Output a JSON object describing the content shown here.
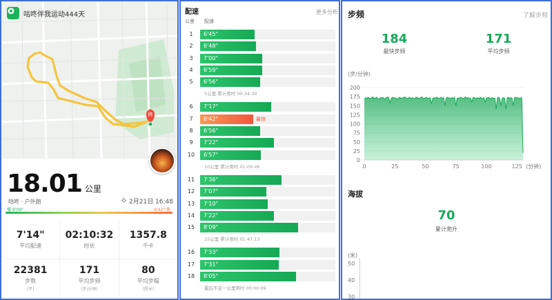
{
  "colors": {
    "accent": "#18a95a",
    "fast": "#f2573e",
    "route": "#f5c43b",
    "border": "#3d6fd6"
  },
  "summary": {
    "app_badge": "咕咚伴我运动444天",
    "distance": "18.01",
    "distance_unit": "公里",
    "activity": "咕咚 · 户外跑",
    "date_time": "2月21日 16:48",
    "slow_label": "慢 8'09\"",
    "fast_label": "6'42\" 快",
    "stats": [
      {
        "value": "7'14\"",
        "label": "平均配速",
        "sub": ""
      },
      {
        "value": "02:10:32",
        "label": "时长",
        "sub": ""
      },
      {
        "value": "1357.8",
        "label": "千卡",
        "sub": ""
      },
      {
        "value": "22381",
        "label": "步数",
        "sub": "(步)"
      },
      {
        "value": "171",
        "label": "平均步频",
        "sub": "(步/分钟)"
      },
      {
        "value": "80",
        "label": "平均步幅",
        "sub": "(厘米)"
      }
    ]
  },
  "pace": {
    "title": "配速",
    "more": "更多分析",
    "col_km": "公里",
    "col_pace": "配速",
    "fastest_tag": "最快",
    "groups": [
      {
        "rows": [
          {
            "km": "1",
            "pace": "6'45\"",
            "sec": 405
          },
          {
            "km": "2",
            "pace": "6'48\"",
            "sec": 408
          },
          {
            "km": "3",
            "pace": "7'00\"",
            "sec": 420
          },
          {
            "km": "4",
            "pace": "6'59\"",
            "sec": 419
          },
          {
            "km": "5",
            "pace": "6'56\"",
            "sec": 416
          }
        ],
        "summary": "5公里 累计用时 00:34:30"
      },
      {
        "rows": [
          {
            "km": "6",
            "pace": "7'17\"",
            "sec": 437
          },
          {
            "km": "7",
            "pace": "6'42\"",
            "sec": 402,
            "fastest": true
          },
          {
            "km": "8",
            "pace": "6'56\"",
            "sec": 416
          },
          {
            "km": "9",
            "pace": "7'22\"",
            "sec": 442
          },
          {
            "km": "10",
            "pace": "6'57\"",
            "sec": 417
          }
        ],
        "summary": "10公里 累计用时 01:09:46"
      },
      {
        "rows": [
          {
            "km": "11",
            "pace": "7'36\"",
            "sec": 456
          },
          {
            "km": "12",
            "pace": "7'07\"",
            "sec": 427
          },
          {
            "km": "13",
            "pace": "7'10\"",
            "sec": 430
          },
          {
            "km": "14",
            "pace": "7'22\"",
            "sec": 442
          },
          {
            "km": "15",
            "pace": "8'09\"",
            "sec": 489
          }
        ],
        "summary": "15公里 累计用时 01:47:13"
      },
      {
        "rows": [
          {
            "km": "16",
            "pace": "7'33\"",
            "sec": 453
          },
          {
            "km": "17",
            "pace": "7'31\"",
            "sec": 451
          },
          {
            "km": "18",
            "pace": "8'05\"",
            "sec": 485
          }
        ],
        "summary": "最后不足一公里用时 00:00:09"
      }
    ]
  },
  "cadence": {
    "title": "步频",
    "more": "了解步频",
    "max_value": "184",
    "max_label": "最快步频",
    "avg_value": "171",
    "avg_label": "平均步频",
    "y_unit": "(步/分钟)",
    "x_unit": "(分钟)"
  },
  "altitude": {
    "title": "海拔",
    "climb_value": "70",
    "climb_label": "累计爬升",
    "unit": "(米)",
    "ticks": [
      "50",
      "40",
      "30"
    ]
  },
  "chart_data": {
    "type": "area",
    "title": "",
    "xlabel": "(分钟)",
    "ylabel": "(步/分钟)",
    "xlim": [
      0,
      130
    ],
    "ylim": [
      0,
      200
    ],
    "xticks": [
      0,
      25,
      50,
      75,
      100,
      125
    ],
    "yticks": [
      0,
      25,
      50,
      75,
      100,
      125,
      150,
      175,
      200
    ],
    "x": [
      0,
      1,
      2,
      3,
      4,
      5,
      6,
      7,
      8,
      9,
      10,
      11,
      12,
      13,
      14,
      15,
      16,
      17,
      18,
      19,
      20,
      21,
      22,
      23,
      24,
      25,
      26,
      27,
      28,
      29,
      30,
      31,
      32,
      33,
      34,
      35,
      36,
      37,
      38,
      39,
      40,
      41,
      42,
      43,
      44,
      45,
      46,
      47,
      48,
      49,
      50,
      51,
      52,
      53,
      54,
      55,
      56,
      57,
      58,
      59,
      60,
      61,
      62,
      63,
      64,
      65,
      66,
      67,
      68,
      69,
      70,
      71,
      72,
      73,
      74,
      75,
      76,
      77,
      78,
      79,
      80,
      81,
      82,
      83,
      84,
      85,
      86,
      87,
      88,
      89,
      90,
      91,
      92,
      93,
      94,
      95,
      96,
      97,
      98,
      99,
      100,
      101,
      102,
      103,
      104,
      105,
      106,
      107,
      108,
      109,
      110,
      111,
      112,
      113,
      114,
      115,
      116,
      117,
      118,
      119,
      120,
      121,
      122,
      123,
      124,
      125,
      126,
      127,
      128,
      129,
      130
    ],
    "series": [
      {
        "values": [
          168,
          172,
          170,
          173,
          171,
          169,
          172,
          174,
          170,
          171,
          173,
          170,
          168,
          172,
          171,
          173,
          170,
          169,
          172,
          174,
          172,
          158,
          170,
          173,
          171,
          172,
          170,
          169,
          171,
          173,
          170,
          172,
          171,
          174,
          172,
          170,
          171,
          173,
          170,
          172,
          171,
          169,
          172,
          173,
          171,
          170,
          172,
          174,
          171,
          170,
          172,
          173,
          170,
          171,
          172,
          155,
          170,
          172,
          171,
          173,
          172,
          170,
          171,
          173,
          170,
          172,
          150,
          171,
          173,
          172,
          170,
          171,
          172,
          170,
          173,
          150,
          171,
          170,
          172,
          173,
          171,
          170,
          172,
          174,
          171,
          172,
          170,
          171,
          160,
          172,
          173,
          170,
          171,
          172,
          170,
          173,
          171,
          170,
          172,
          160,
          171,
          172,
          173,
          170,
          171,
          172,
          170,
          171,
          140,
          172,
          173,
          170,
          150,
          171,
          172,
          170,
          140,
          171,
          173,
          170,
          172,
          171,
          150,
          172,
          173,
          171,
          172,
          170,
          171,
          172,
          20
        ]
      }
    ]
  }
}
